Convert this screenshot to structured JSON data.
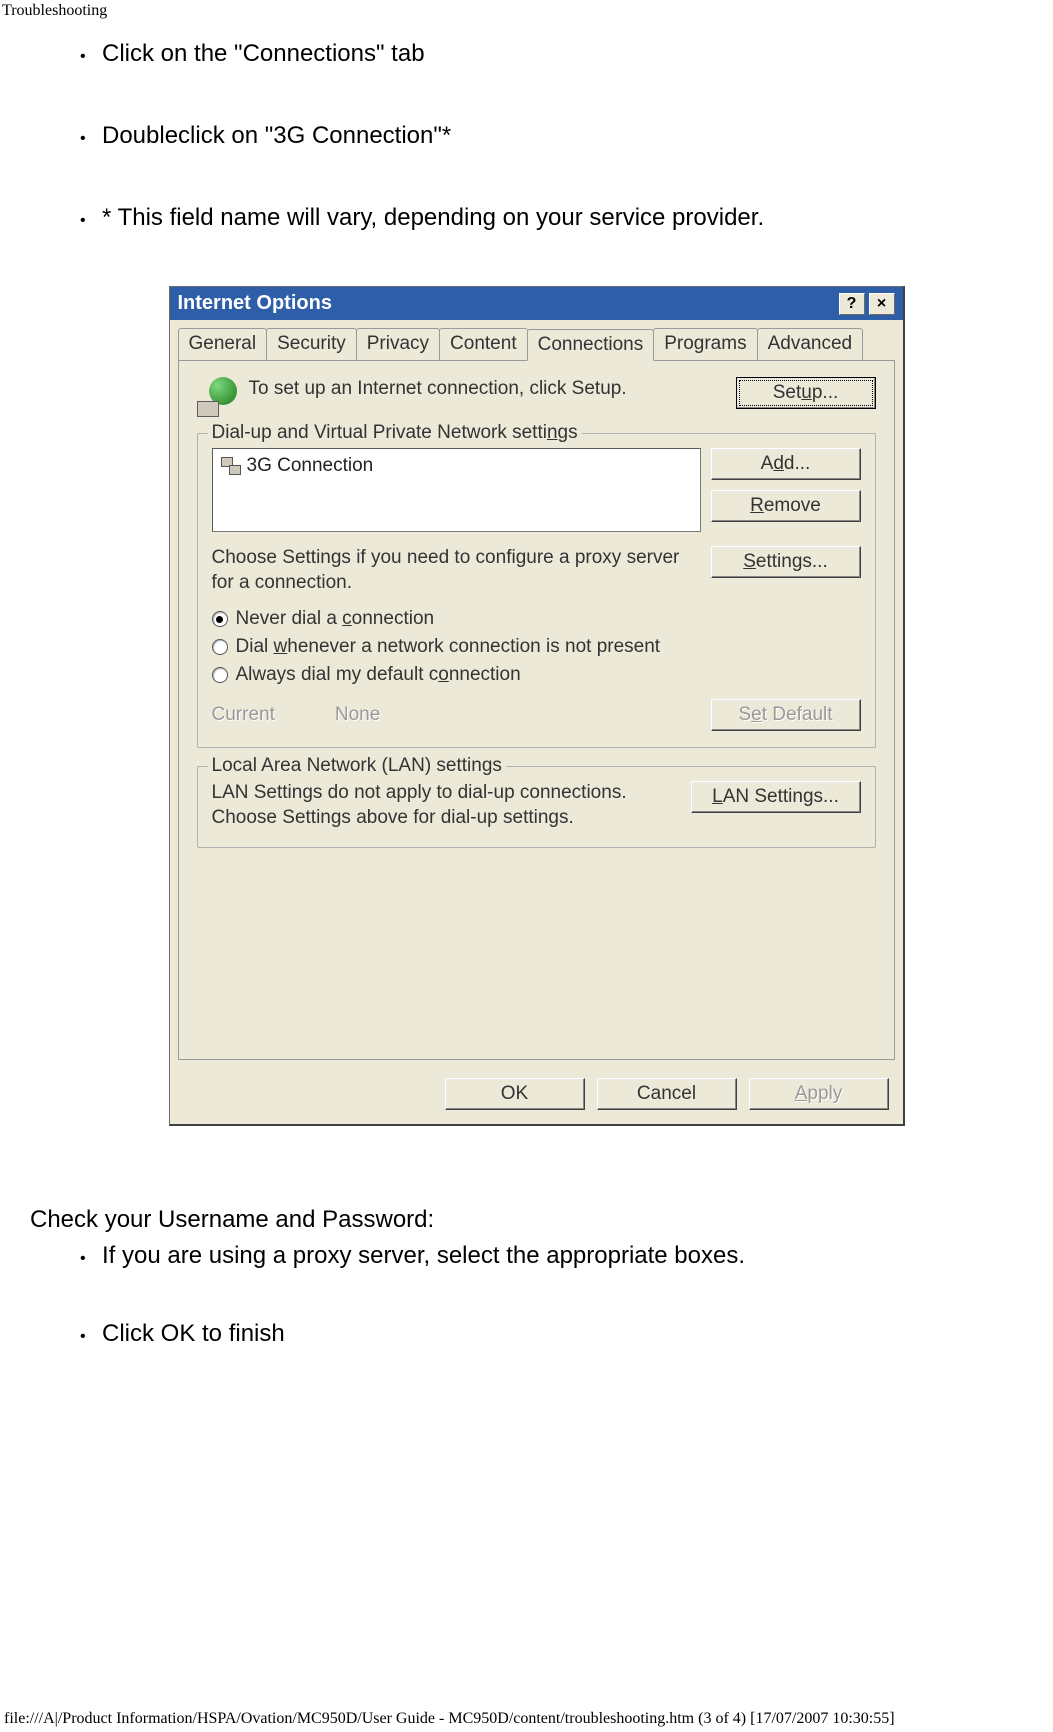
{
  "page": {
    "header": "Troubleshooting",
    "bullets_top": [
      "Click on the \"Connections\" tab",
      "Doubleclick on \"3G Connection\"*",
      "* This field name will vary, depending on your service provider."
    ],
    "after_heading": "Check your Username and Password:",
    "bullets_bottom": [
      "If you are using a proxy server, select the appropriate boxes.",
      "Click OK to finish"
    ],
    "footer": "file:///A|/Product Information/HSPA/Ovation/MC950D/User Guide - MC950D/content/troubleshooting.htm (3 of 4) [17/07/2007 10:30:55]"
  },
  "dialog": {
    "title": "Internet Options",
    "titlebar_help": "?",
    "titlebar_close": "×",
    "tabs": [
      "General",
      "Security",
      "Privacy",
      "Content",
      "Connections",
      "Programs",
      "Advanced"
    ],
    "active_tab": "Connections",
    "setup_text": "To set up an Internet connection, click Setup.",
    "setup_button": "Setup...",
    "dialup": {
      "group_label": "Dial-up and Virtual Private Network settings",
      "list_item": "3G Connection",
      "add_button": "Add...",
      "remove_button": "Remove",
      "proxy_text": "Choose Settings if you need to configure a proxy server for a connection.",
      "settings_button": "Settings...",
      "radios": [
        "Never dial a connection",
        "Dial whenever a network connection is not present",
        "Always dial my default connection"
      ],
      "selected_radio": 0,
      "current_label": "Current",
      "current_value": "None",
      "set_default_button": "Set Default"
    },
    "lan": {
      "group_label": "Local Area Network (LAN) settings",
      "text": "LAN Settings do not apply to dial-up connections. Choose Settings above for dial-up settings.",
      "button": "LAN Settings..."
    },
    "actions": {
      "ok": "OK",
      "cancel": "Cancel",
      "apply": "Apply"
    }
  }
}
